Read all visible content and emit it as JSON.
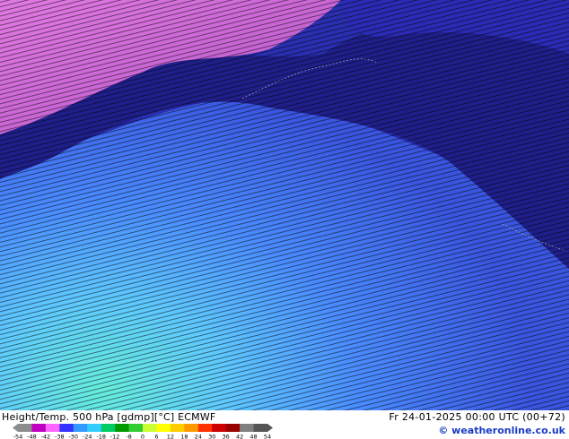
{
  "footer": {
    "title": "Height/Temp. 500 hPa [gdmp][°C] ECMWF",
    "datetime": "Fr 24-01-2025 00:00 UTC (00+72)",
    "credit": "© weatheronline.co.uk"
  },
  "legend": {
    "ticks": [
      "-54",
      "-48",
      "-42",
      "-38",
      "-30",
      "-24",
      "-18",
      "-12",
      "-8",
      "0",
      "6",
      "12",
      "18",
      "24",
      "30",
      "36",
      "42",
      "48",
      "54"
    ],
    "colors": [
      "#8c8c8c",
      "#c000c0",
      "#ff66ff",
      "#3333ff",
      "#3399ff",
      "#33ccff",
      "#00cc66",
      "#009900",
      "#33cc33",
      "#ccff33",
      "#ffff00",
      "#ffcc00",
      "#ff9900",
      "#ff3300",
      "#cc0000",
      "#990000",
      "#808080",
      "#555555"
    ]
  },
  "map": {
    "colors": {
      "magenta_cold": "#d66cd6",
      "navy": "#1f1f8a",
      "dark_blue": "#2a2fb0",
      "mid_blue": "#3a56e0",
      "light_blue": "#4a8cff",
      "cyan": "#5ec8ff",
      "aqua": "#66eedd"
    }
  }
}
